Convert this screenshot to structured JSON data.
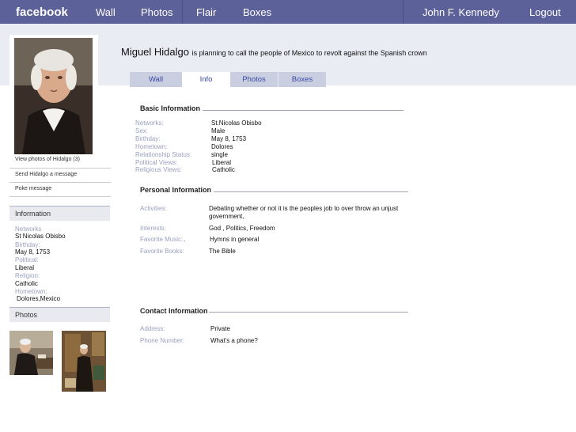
{
  "nav": {
    "logo": "facebook",
    "wall": "Wall",
    "photos": "Photos",
    "flair": "Flair",
    "boxes": "Boxes",
    "user": "John F. Kennedy",
    "logout": "Logout"
  },
  "profile": {
    "name": "Miguel Hidalgo",
    "status": "is planning to call the people of Mexico to revolt against the Spanish crown"
  },
  "tabs": [
    "Wall",
    "Info",
    "Photos",
    "Boxes"
  ],
  "sidebar": {
    "view_photos": "View photos of Hidalgo (3)",
    "send_message": "Send Hidalgo a message",
    "poke": "Poke message",
    "info_title": "Information",
    "info": [
      {
        "label": "Networks",
        "value": "St Nicolas Obisbo"
      },
      {
        "label": "Birthday:",
        "value": "May 8, 1753"
      },
      {
        "label": "Political:",
        "value": "Liberal"
      },
      {
        "label": "Religion:",
        "value": "Catholic"
      },
      {
        "label": "Hometown:",
        "value": "Dolores,Mexico"
      }
    ],
    "photos_title": "Photos"
  },
  "basic": {
    "title": "Basic Information",
    "rows": [
      {
        "label": "Networks:",
        "value": "St.Nicolas Obisbo"
      },
      {
        "label": "Sex:",
        "value": "Male"
      },
      {
        "label": "Birthday:",
        "value": "May 8, 1753"
      },
      {
        "label": "Hometown:",
        "value": "Dolores"
      },
      {
        "label": "Relationship Status:",
        "value": "single"
      },
      {
        "label": "Political Views:",
        "value": "Liberal"
      },
      {
        "label": "Religious Views:",
        "value": "Catholic"
      }
    ]
  },
  "personal": {
    "title": "Personal Information",
    "activities_label": "Activities:",
    "activities_line1": "Debating whether or not it is the peoples job to over throw an unjust",
    "activities_line2": "government,",
    "interests_label": "Interests:",
    "interests": "God , Politics,  Freedom",
    "music_label": "Favorite Music:",
    "music_dot": ".",
    "music": "Hymns in general",
    "books_label": "Favorite Books:",
    "books": "The Bible"
  },
  "contact": {
    "title": "Contact Information",
    "address_label": "Address:",
    "address": "Private",
    "phone_label": "Phone Number:",
    "phone": "What's a phone?"
  },
  "colors": {
    "nav_bg": "#5d6199",
    "band_bg": "#e9ecf2",
    "tab_bg": "#c9cee0",
    "label": "#9aa0be",
    "link": "#3b4aa5"
  }
}
